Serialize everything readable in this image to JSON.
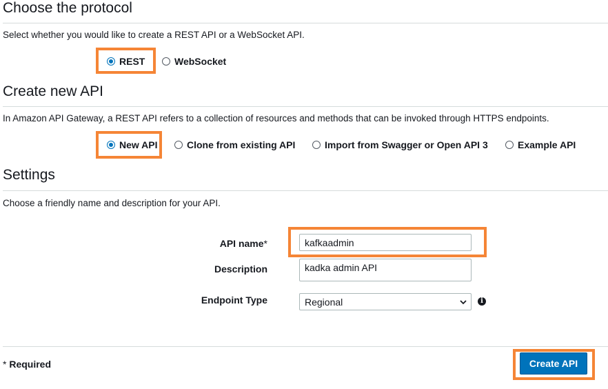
{
  "protocol": {
    "heading": "Choose the protocol",
    "description": "Select whether you would like to create a REST API or a WebSocket API.",
    "options": [
      {
        "label": "REST",
        "selected": true
      },
      {
        "label": "WebSocket",
        "selected": false
      }
    ]
  },
  "create": {
    "heading": "Create new API",
    "description": "In Amazon API Gateway, a REST API refers to a collection of resources and methods that can be invoked through HTTPS endpoints.",
    "options": [
      {
        "label": "New API",
        "selected": true
      },
      {
        "label": "Clone from existing API",
        "selected": false
      },
      {
        "label": "Import from Swagger or Open API 3",
        "selected": false
      },
      {
        "label": "Example API",
        "selected": false
      }
    ]
  },
  "settings": {
    "heading": "Settings",
    "description": "Choose a friendly name and description for your API.",
    "api_name": {
      "label": "API name",
      "required_mark": "*",
      "value": "kafkaadmin"
    },
    "description_field": {
      "label": "Description",
      "value": "kadka admin API"
    },
    "endpoint_type": {
      "label": "Endpoint Type",
      "value": "Regional",
      "info_glyph": "i"
    }
  },
  "footer": {
    "required_star": "*",
    "required_text": "Required",
    "create_button": "Create API"
  },
  "colors": {
    "accent": "#0073bb",
    "highlight": "#f58536"
  }
}
